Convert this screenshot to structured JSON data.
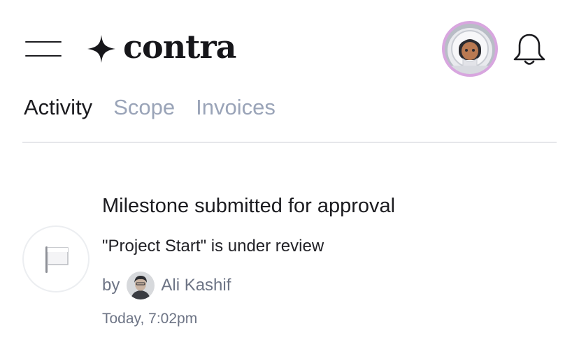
{
  "header": {
    "menu_icon": "hamburger-menu-icon",
    "logo_text": "contra",
    "logo_icon": "four-point-star-icon",
    "profile_avatar_icon": "astronaut-avatar",
    "notifications_icon": "bell-icon"
  },
  "tabs": [
    {
      "label": "Activity",
      "active": true
    },
    {
      "label": "Scope",
      "active": false
    },
    {
      "label": "Invoices",
      "active": false
    }
  ],
  "activity": {
    "icon": "white-flag-icon",
    "title": "Milestone submitted for approval",
    "description": "\"Project Start\" is under review",
    "by_label": "by",
    "user_name": "Ali Kashif",
    "timestamp": "Today, 7:02pm"
  },
  "colors": {
    "text_primary": "#1b1b1f",
    "tab_inactive": "#9aa4b8",
    "text_secondary": "#6d7485",
    "divider": "#e6e7ea",
    "avatar_ring": "#d8a6df"
  }
}
